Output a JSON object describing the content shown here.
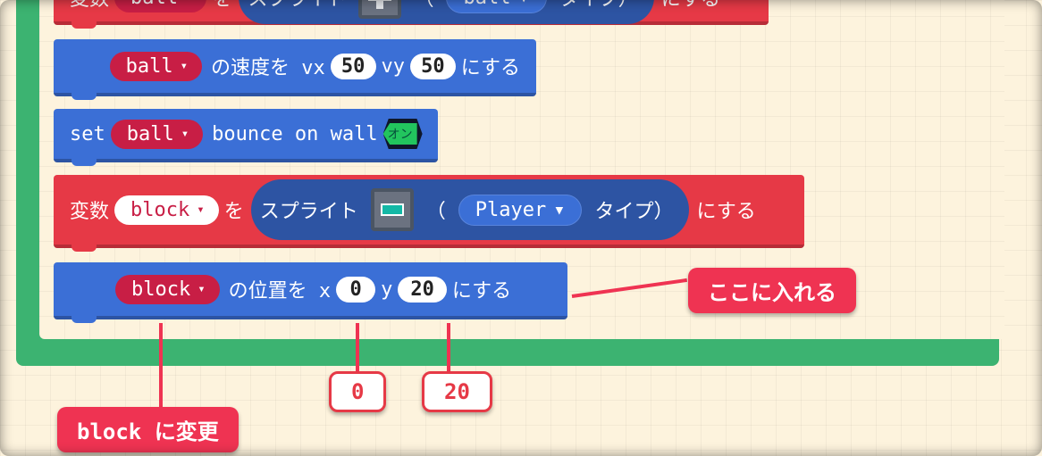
{
  "row1": {
    "prefix_var": "変数",
    "var_name": "ball",
    "label_wo": "を",
    "sprite_label": "スプライト",
    "open_paren": "（",
    "type_name": "ball",
    "type_suffix": "タイプ）",
    "set_suffix": "にする"
  },
  "row2": {
    "var_name": "ball",
    "label_pre": "の速度を vx",
    "vx": "50",
    "label_mid": "vy",
    "vy": "50",
    "suffix": "にする"
  },
  "row3": {
    "set_label": "set",
    "var_name": "ball",
    "bounce_label": "bounce on wall",
    "toggle_text": "オン"
  },
  "row4": {
    "prefix_var": "変数",
    "var_name": "block",
    "label_wo": "を",
    "sprite_label": "スプライト",
    "open_paren": "（",
    "type_name": "Player",
    "type_suffix": "タイプ）",
    "set_suffix": "にする"
  },
  "row5": {
    "var_name": "block",
    "label_pre": "の位置を x",
    "x": "0",
    "label_mid": "y",
    "y": "20",
    "suffix": "にする"
  },
  "callouts": {
    "insert_here": "ここに入れる",
    "change_to_block": "block に変更",
    "num_0": "0",
    "num_20": "20"
  }
}
